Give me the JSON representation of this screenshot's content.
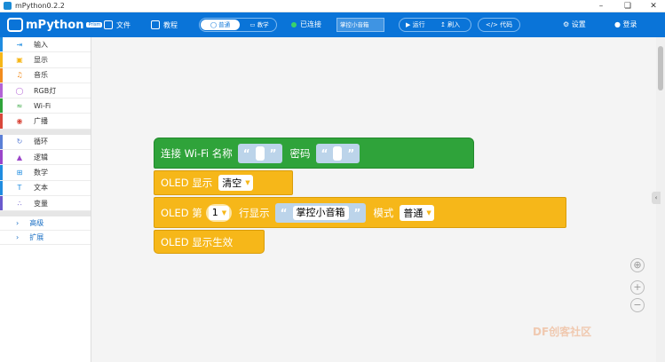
{
  "window": {
    "title": "mPython0.2.2"
  },
  "toolbar": {
    "logo_text": "mPython",
    "logo_tag": "Prism",
    "file_label": "文件",
    "tutorial_label": "教程",
    "mode_normal": "普通",
    "mode_teach": "教学",
    "status_connected": "已连接",
    "device_name": "掌控小音箱",
    "run_label": "运行",
    "flash_label": "刷入",
    "code_label": "代码",
    "settings_label": "设置",
    "login_label": "登录",
    "accent": "#0a74d8"
  },
  "sidebar": {
    "categories": [
      {
        "label": "输入",
        "icon": "input-icon",
        "color": "#1f8ce0"
      },
      {
        "label": "显示",
        "icon": "display-icon",
        "color": "#f6b719"
      },
      {
        "label": "音乐",
        "icon": "music-icon",
        "color": "#f28c1e"
      },
      {
        "label": "RGB灯",
        "icon": "bulb-icon",
        "color": "#b363d6"
      },
      {
        "label": "Wi-Fi",
        "icon": "wifi-icon",
        "color": "#2fa33a"
      },
      {
        "label": "广播",
        "icon": "broadcast-icon",
        "color": "#d9483b"
      },
      {
        "label": "循环",
        "icon": "loop-icon",
        "color": "#5b7fd6"
      },
      {
        "label": "逻辑",
        "icon": "logic-icon",
        "color": "#9b45c9"
      },
      {
        "label": "数学",
        "icon": "math-icon",
        "color": "#1f8ce0"
      },
      {
        "label": "文本",
        "icon": "text-icon",
        "color": "#1f8ce0"
      },
      {
        "label": "变量",
        "icon": "variable-icon",
        "color": "#6a5acd"
      }
    ],
    "sections": [
      {
        "label": "高级"
      },
      {
        "label": "扩展"
      }
    ]
  },
  "blocks": {
    "wifi_connect": {
      "label": "连接 Wi-Fi 名称",
      "password_label": "密码",
      "ssid_value": "",
      "password_value": ""
    },
    "oled_show": {
      "label": "OLED 显示",
      "option": "清空"
    },
    "oled_line": {
      "label_prefix": "OLED 第",
      "line": "1",
      "label_mid": "行显示",
      "text": "掌控小音箱",
      "label_mode": "模式",
      "mode": "普通"
    },
    "oled_effect": {
      "label": "OLED 显示生效"
    }
  },
  "watermark": {
    "text": "DF创客社区"
  }
}
